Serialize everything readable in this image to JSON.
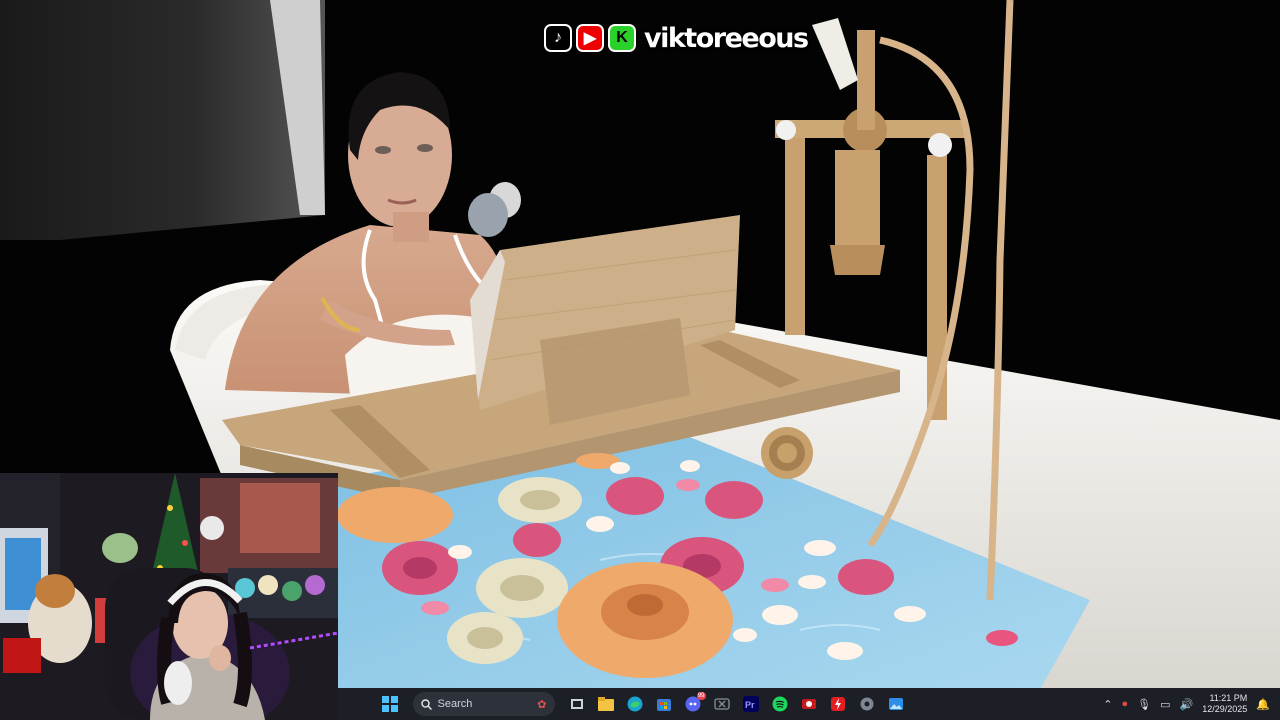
{
  "overlay": {
    "handle": "viktoreeous",
    "icons": [
      "tiktok-icon",
      "youtube-icon",
      "kick-icon"
    ]
  },
  "taskbar": {
    "search_label": "Search",
    "pinned": [
      "file-explorer",
      "edge",
      "microsoft-store",
      "discord",
      "xbox",
      "premiere-pro",
      "spotify",
      "obs",
      "streamlabs",
      "settings",
      "photos"
    ],
    "discord_badge": "99",
    "clock": {
      "time": "11:21 PM",
      "date": "12/29/2025"
    }
  },
  "colors": {
    "taskbar_bg": "#1c1f26",
    "water": "#8fc8e6",
    "tub": "#f4f2ee",
    "wood": "#c9a97f",
    "brass": "#c9a171"
  }
}
